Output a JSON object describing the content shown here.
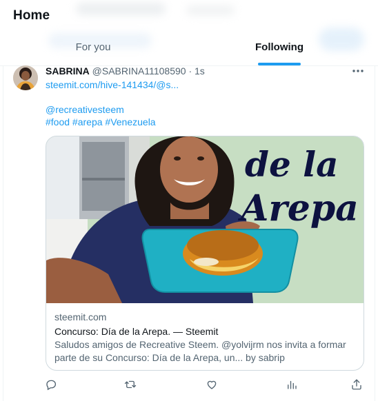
{
  "header": {
    "title": "Home",
    "tabs": [
      {
        "label": "For you",
        "active": false
      },
      {
        "label": "Following",
        "active": true
      }
    ]
  },
  "tweet": {
    "author_name": "SABRINA",
    "handle": "@SABRINA11108590",
    "separator": "·",
    "time": "1s",
    "link": "steemit.com/hive-141434/@s...",
    "mention": "@recreativesteem",
    "hashtags": "#food #arepa #Venezuela",
    "card": {
      "image_text_line1": "de la",
      "image_text_line2": "Arepa",
      "domain": "steemit.com",
      "title": "Concurso: Día de la Arepa. — Steemit",
      "description": "Saludos amigos de Recreative Steem. @yolvijrm nos invita a formar parte de su Concurso: Día de la Arepa, un... by sabrip"
    }
  },
  "colors": {
    "accent": "#1d9bf0",
    "text_primary": "#0f1419",
    "text_secondary": "#536471",
    "border": "#cfd9de",
    "plate": "#1fb0c4",
    "image_bg": "#c9dfc4"
  },
  "icons": {
    "more": "more-horizontal-icon",
    "reply": "reply-icon",
    "retweet": "retweet-icon",
    "like": "heart-icon",
    "views": "views-icon",
    "share": "share-icon"
  }
}
